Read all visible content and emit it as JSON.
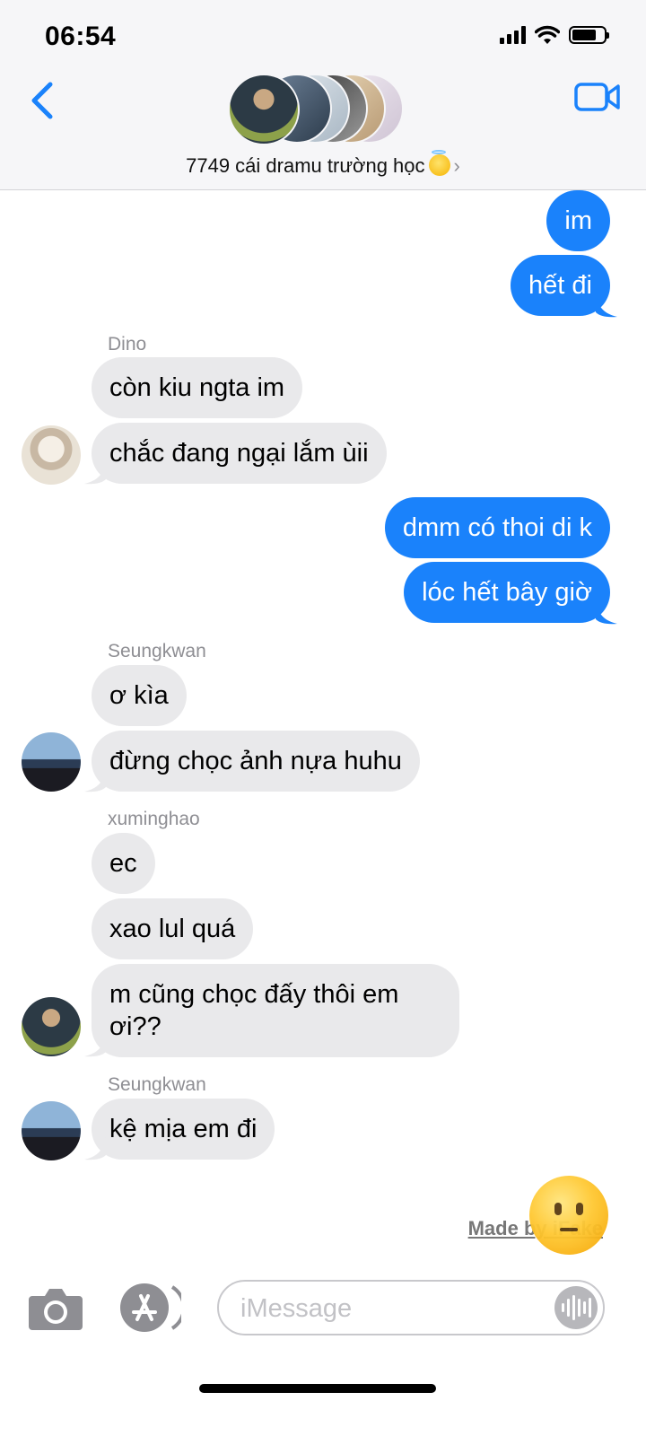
{
  "status_bar": {
    "time": "06:54"
  },
  "header": {
    "group_name": "7749 cái dramu trường học",
    "chevron": "›",
    "back_icon": "chevron-left-icon",
    "video_icon": "video-camera-icon",
    "avatar_colors": [
      "#2c3a45",
      "#6b7c8f",
      "#cfd8e0",
      "#3d3d3d",
      "#d9c9b0",
      "#e7dfe9"
    ]
  },
  "messages": [
    {
      "id": "m1",
      "direction": "sent",
      "text": "im"
    },
    {
      "id": "m2",
      "direction": "sent",
      "text": "hết đi"
    },
    {
      "id": "s1",
      "sender": "Dino"
    },
    {
      "id": "m3",
      "direction": "received",
      "text": "còn kiu ngta im"
    },
    {
      "id": "m4",
      "direction": "received",
      "text": "chắc đang ngại lắm ùii"
    },
    {
      "id": "m5",
      "direction": "sent",
      "text": "dmm có thoi di k"
    },
    {
      "id": "m6",
      "direction": "sent",
      "text": "lóc hết bây giờ"
    },
    {
      "id": "s2",
      "sender": "Seungkwan"
    },
    {
      "id": "m7",
      "direction": "received",
      "text": "ơ kìa"
    },
    {
      "id": "m8",
      "direction": "received",
      "text": "đừng chọc ảnh nựa huhu"
    },
    {
      "id": "s3",
      "sender": "xuminghao"
    },
    {
      "id": "m9",
      "direction": "received",
      "text": "ec"
    },
    {
      "id": "m10",
      "direction": "received",
      "text": "xao lul quá"
    },
    {
      "id": "m11",
      "direction": "received",
      "text_line1": "m cũng chọc đấy thôi em",
      "text_line2": "ơi??"
    },
    {
      "id": "s4",
      "sender": "Seungkwan"
    },
    {
      "id": "m12",
      "direction": "received",
      "text": "kệ mịa em đi"
    }
  ],
  "watermark": "Made by iFake",
  "input_bar": {
    "placeholder": "iMessage",
    "camera_icon": "camera-icon",
    "apps_icon": "app-store-icon",
    "audio_icon": "audio-waveform-icon"
  },
  "colors": {
    "sent_bubble": "#1a82fb",
    "received_bubble": "#e9e9eb",
    "accent": "#1a82fb"
  }
}
